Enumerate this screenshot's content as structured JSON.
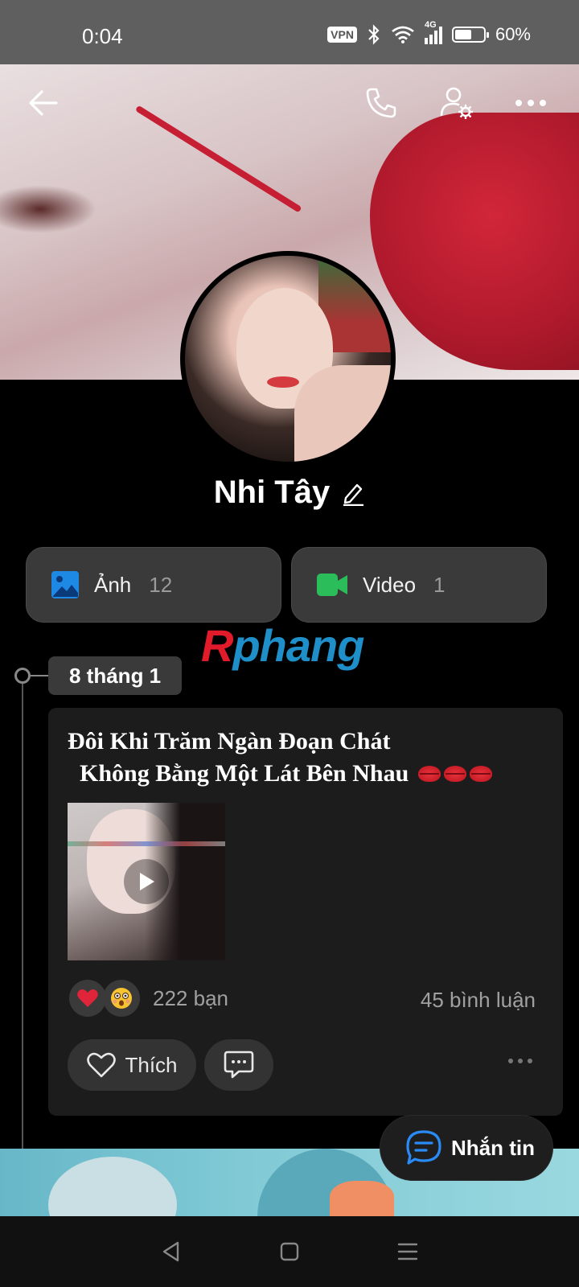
{
  "status_bar": {
    "time": "0:04",
    "vpn": "VPN",
    "network": "4G",
    "battery": "60%",
    "battery_level": 0.6
  },
  "header": {
    "back_icon": "arrow-left-icon",
    "call_icon": "phone-icon",
    "settings_icon": "user-settings-icon",
    "more_icon": "more-horizontal-icon"
  },
  "profile": {
    "name": "Nhi Tây",
    "edit_icon": "pencil-icon"
  },
  "media": {
    "photos": {
      "label": "Ảnh",
      "count": "12",
      "icon": "image-icon",
      "color": "#1e88e5"
    },
    "videos": {
      "label": "Video",
      "count": "1",
      "icon": "video-camera-icon",
      "color": "#2bbd5a"
    }
  },
  "watermark": {
    "prefix": "R",
    "text": "phang"
  },
  "timeline": {
    "date": "8 tháng 1"
  },
  "post": {
    "line1": "Đôi Khi Trăm Ngàn Đoạn Chát",
    "line2": "  Không Bằng Một Lát Bên Nhau",
    "reactions": [
      "heart",
      "surprised-face"
    ],
    "reaction_count": "222 bạn",
    "comment_count": "45 bình luận",
    "like_label": "Thích",
    "comment_icon": "comment-icon",
    "more_icon": "more-horizontal-icon"
  },
  "fab": {
    "label": "Nhắn tin",
    "icon": "chat-bubble-icon",
    "accent": "#2a8af6"
  },
  "nav": {
    "back": "nav-back-icon",
    "home": "nav-home-icon",
    "menu": "nav-menu-icon"
  }
}
